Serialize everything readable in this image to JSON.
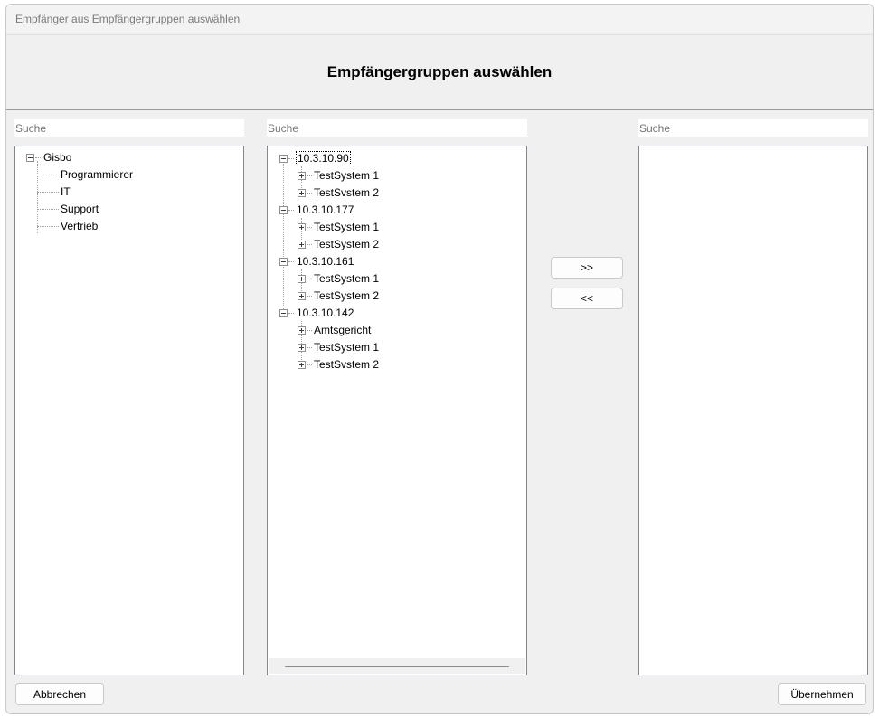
{
  "window": {
    "title": "Empfänger aus Empfängergruppen auswählen"
  },
  "header": {
    "title": "Empfängergruppen auswählen"
  },
  "left": {
    "search_placeholder": "Suche",
    "tree": {
      "root": "Gisbo",
      "children": [
        "Programmierer",
        "IT",
        "Support",
        "Vertrieb"
      ]
    }
  },
  "middle": {
    "search_placeholder": "Suche",
    "servers": [
      {
        "name": "10.3.10.90",
        "children": [
          "TestSystem 1",
          "TestSvstem 2"
        ]
      },
      {
        "name": "10.3.10.177",
        "children": [
          "TestSystem 1",
          "TestSystem 2"
        ]
      },
      {
        "name": "10.3.10.161",
        "children": [
          "TestSystem 1",
          "TestSystem 2"
        ]
      },
      {
        "name": "10.3.10.142",
        "children": [
          "Amtsgericht",
          "TestSystem 1",
          "TestSvstem 2"
        ]
      }
    ]
  },
  "right": {
    "search_placeholder": "Suche"
  },
  "buttons": {
    "add": ">>",
    "remove": "<<",
    "cancel": "Abbrechen",
    "apply": "Übernehmen"
  }
}
